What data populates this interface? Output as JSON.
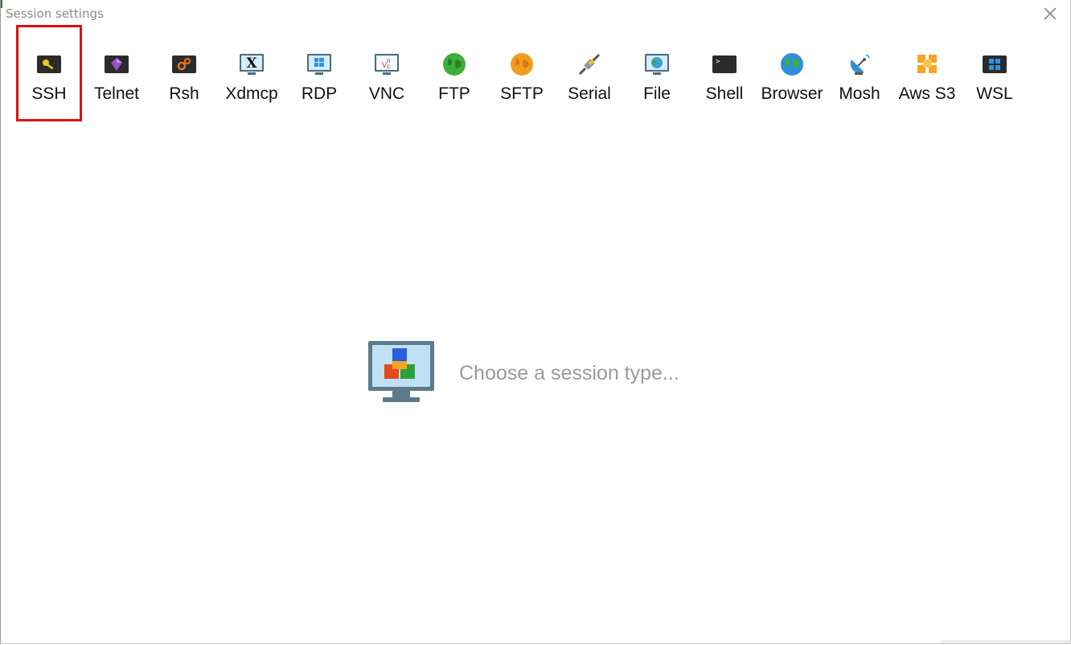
{
  "window": {
    "title": "Session settings"
  },
  "session_types": [
    {
      "label": "SSH",
      "icon": "ssh-key-icon",
      "selected": true
    },
    {
      "label": "Telnet",
      "icon": "telnet-gem-icon"
    },
    {
      "label": "Rsh",
      "icon": "rsh-gears-icon"
    },
    {
      "label": "Xdmcp",
      "icon": "xdmcp-x-icon"
    },
    {
      "label": "RDP",
      "icon": "rdp-windows-icon"
    },
    {
      "label": "VNC",
      "icon": "vnc-icon"
    },
    {
      "label": "FTP",
      "icon": "ftp-globe-icon"
    },
    {
      "label": "SFTP",
      "icon": "sftp-globe-icon"
    },
    {
      "label": "Serial",
      "icon": "serial-plug-icon"
    },
    {
      "label": "File",
      "icon": "file-monitor-icon"
    },
    {
      "label": "Shell",
      "icon": "shell-terminal-icon"
    },
    {
      "label": "Browser",
      "icon": "browser-globe-icon"
    },
    {
      "label": "Mosh",
      "icon": "mosh-satellite-icon"
    },
    {
      "label": "Aws S3",
      "icon": "aws-s3-cubes-icon"
    },
    {
      "label": "WSL",
      "icon": "wsl-windows-icon"
    }
  ],
  "main": {
    "hint": "Choose a session type..."
  }
}
